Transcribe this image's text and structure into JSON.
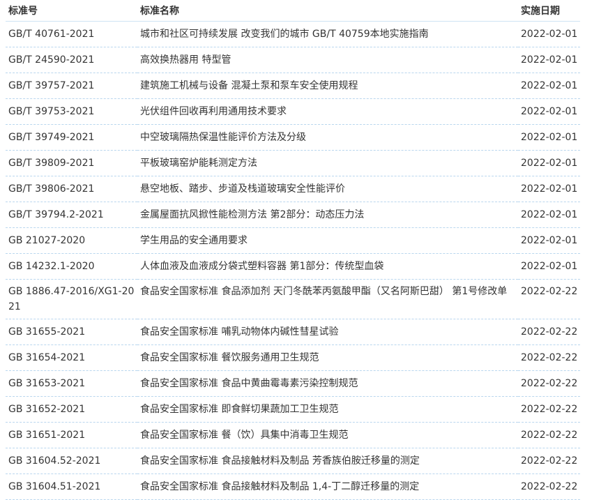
{
  "header": {
    "col_number": "标准号",
    "col_name": "标准名称",
    "col_date": "实施日期"
  },
  "rows": [
    {
      "number": "GB/T 40761-2021",
      "name": "城市和社区可持续发展 改变我们的城市 GB/T 40759本地实施指南",
      "date": "2022-02-01"
    },
    {
      "number": "GB/T 24590-2021",
      "name": "高效换热器用 特型管",
      "date": "2022-02-01"
    },
    {
      "number": "GB/T 39757-2021",
      "name": "建筑施工机械与设备 混凝土泵和泵车安全使用规程",
      "date": "2022-02-01"
    },
    {
      "number": "GB/T 39753-2021",
      "name": "光伏组件回收再利用通用技术要求",
      "date": "2022-02-01"
    },
    {
      "number": "GB/T 39749-2021",
      "name": "中空玻璃隔热保温性能评价方法及分级",
      "date": "2022-02-01"
    },
    {
      "number": "GB/T 39809-2021",
      "name": "平板玻璃窑炉能耗测定方法",
      "date": "2022-02-01"
    },
    {
      "number": "GB/T 39806-2021",
      "name": "悬空地板、踏步、步道及栈道玻璃安全性能评价",
      "date": "2022-02-01"
    },
    {
      "number": "GB/T 39794.2-2021",
      "name": "金属屋面抗风掀性能检测方法 第2部分：动态压力法",
      "date": "2022-02-01"
    },
    {
      "number": "GB 21027-2020",
      "name": "学生用品的安全通用要求",
      "date": "2022-02-01"
    },
    {
      "number": "GB 14232.1-2020",
      "name": "人体血液及血液成分袋式塑料容器 第1部分：传统型血袋",
      "date": "2022-02-01"
    },
    {
      "number": "GB 1886.47-2016/XG1-2021",
      "name": "食品安全国家标准 食品添加剂 天门冬酰苯丙氨酸甲酯（又名阿斯巴甜） 第1号修改单",
      "date": "2022-02-22"
    },
    {
      "number": "GB 31655-2021",
      "name": "食品安全国家标准 哺乳动物体内碱性彗星试验",
      "date": "2022-02-22"
    },
    {
      "number": "GB 31654-2021",
      "name": "食品安全国家标准 餐饮服务通用卫生规范",
      "date": "2022-02-22"
    },
    {
      "number": "GB 31653-2021",
      "name": "食品安全国家标准 食品中黄曲霉毒素污染控制规范",
      "date": "2022-02-22"
    },
    {
      "number": "GB 31652-2021",
      "name": "食品安全国家标准 即食鲜切果蔬加工卫生规范",
      "date": "2022-02-22"
    },
    {
      "number": "GB 31651-2021",
      "name": "食品安全国家标准 餐（饮）具集中消毒卫生规范",
      "date": "2022-02-22"
    },
    {
      "number": "GB 31604.52-2021",
      "name": "食品安全国家标准 食品接触材料及制品 芳香族伯胺迁移量的测定",
      "date": "2022-02-22"
    },
    {
      "number": "GB 31604.51-2021",
      "name": "食品安全国家标准 食品接触材料及制品 1,4-丁二醇迁移量的测定",
      "date": "2022-02-22"
    }
  ]
}
